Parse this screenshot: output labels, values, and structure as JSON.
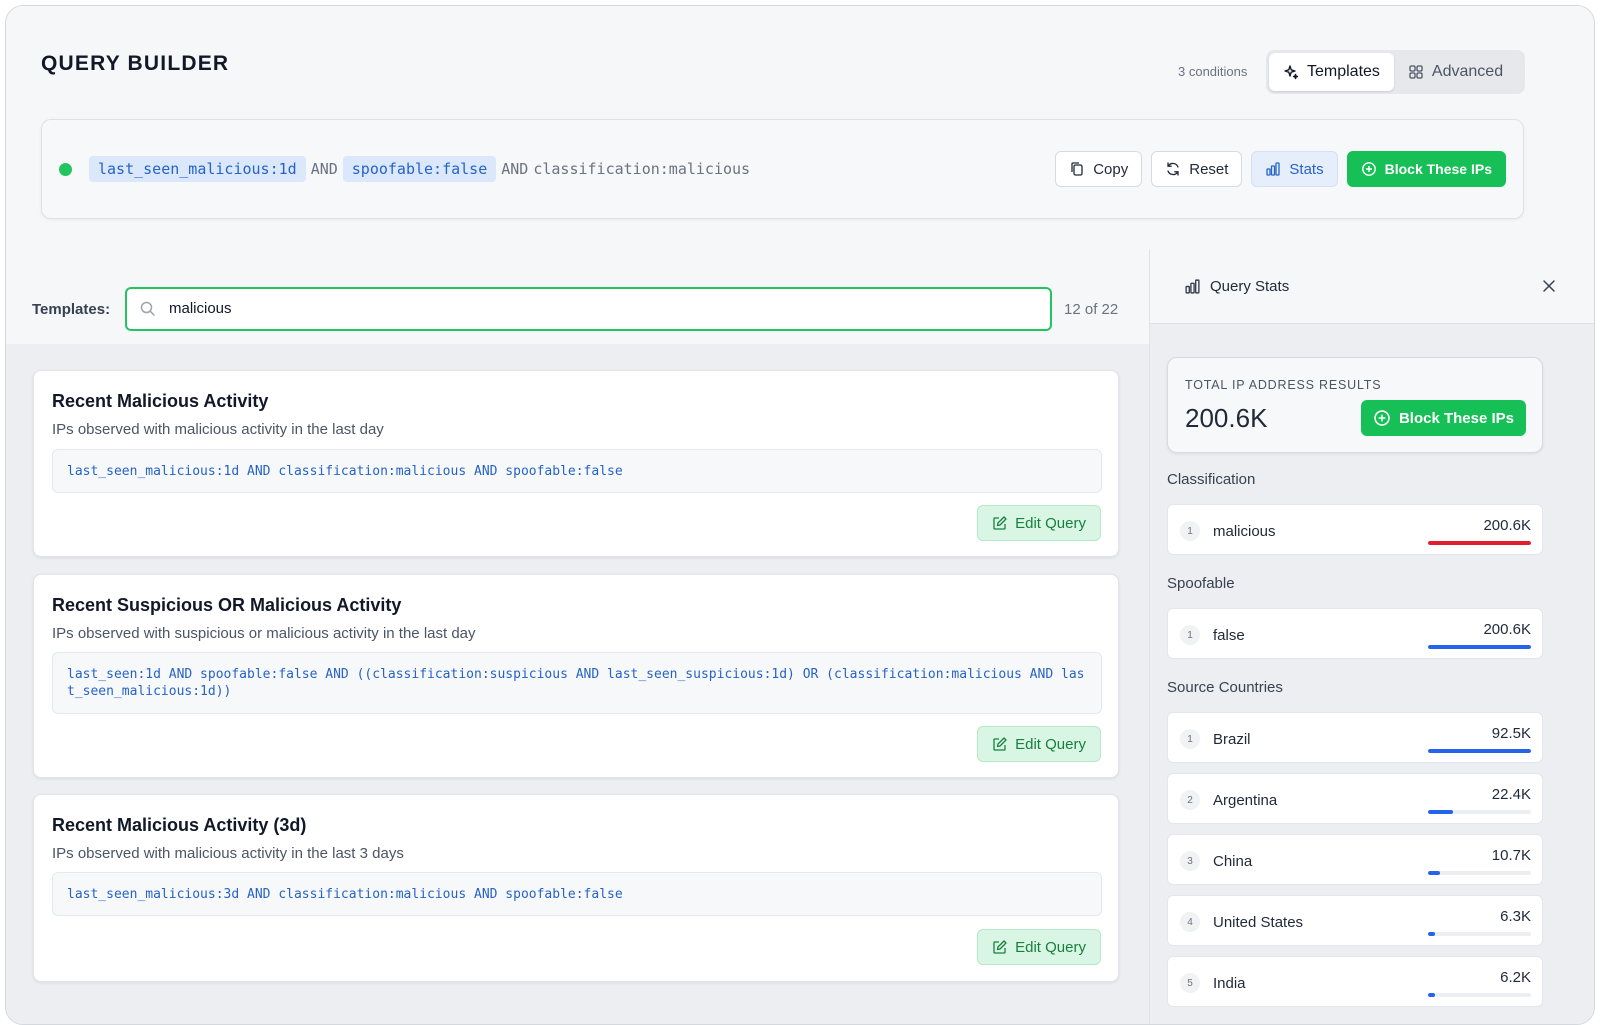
{
  "header": {
    "title": "QUERY BUILDER",
    "conditions_count": "3 conditions",
    "tabs": [
      {
        "label": "Templates",
        "icon": "sparkles-icon",
        "active": true
      },
      {
        "label": "Advanced",
        "icon": "grid-icon",
        "active": false
      }
    ]
  },
  "query": {
    "tokens": [
      {
        "text": "last_seen_malicious:1d",
        "style": "pill"
      },
      {
        "text": "AND",
        "style": "op"
      },
      {
        "text": "spoofable:false",
        "style": "pill"
      },
      {
        "text": "AND",
        "style": "op"
      },
      {
        "text": "classification:malicious",
        "style": "plain"
      }
    ],
    "actions": {
      "copy": "Copy",
      "reset": "Reset",
      "stats": "Stats",
      "block": "Block These IPs"
    }
  },
  "templates": {
    "label": "Templates:",
    "search_value": "malicious",
    "result_count": "12 of 22",
    "edit_label": "Edit Query",
    "cards": [
      {
        "title": "Recent Malicious Activity",
        "description": "IPs observed with malicious activity in the last day",
        "query": "last_seen_malicious:1d AND classification:malicious AND spoofable:false"
      },
      {
        "title": "Recent Suspicious OR Malicious Activity",
        "description": "IPs observed with suspicious or malicious activity in the last day",
        "query": "last_seen:1d AND spoofable:false AND ((classification:suspicious AND last_seen_suspicious:1d) OR (classification:malicious AND last_seen_malicious:1d))"
      },
      {
        "title": "Recent Malicious Activity (3d)",
        "description": "IPs observed with malicious activity in the last 3 days",
        "query": "last_seen_malicious:3d AND classification:malicious AND spoofable:false"
      }
    ]
  },
  "stats": {
    "title": "Query Stats",
    "total_label": "TOTAL IP ADDRESS RESULTS",
    "total_value": "200.6K",
    "block_label": "Block These IPs",
    "sections": {
      "classification": {
        "title": "Classification",
        "rows": [
          {
            "rank": "1",
            "name": "malicious",
            "value": "200.6K",
            "fraction": 1.0,
            "color": "#e11d2e"
          }
        ]
      },
      "spoofable": {
        "title": "Spoofable",
        "rows": [
          {
            "rank": "1",
            "name": "false",
            "value": "200.6K",
            "fraction": 1.0,
            "color": "#2563eb"
          }
        ]
      },
      "countries": {
        "title": "Source Countries",
        "rows": [
          {
            "rank": "1",
            "name": "Brazil",
            "value": "92.5K",
            "fraction": 1.0,
            "color": "#2563eb"
          },
          {
            "rank": "2",
            "name": "Argentina",
            "value": "22.4K",
            "fraction": 0.24,
            "color": "#2563eb"
          },
          {
            "rank": "3",
            "name": "China",
            "value": "10.7K",
            "fraction": 0.12,
            "color": "#2563eb"
          },
          {
            "rank": "4",
            "name": "United States",
            "value": "6.3K",
            "fraction": 0.07,
            "color": "#2563eb"
          },
          {
            "rank": "5",
            "name": "India",
            "value": "6.2K",
            "fraction": 0.07,
            "color": "#2563eb"
          }
        ]
      }
    }
  }
}
